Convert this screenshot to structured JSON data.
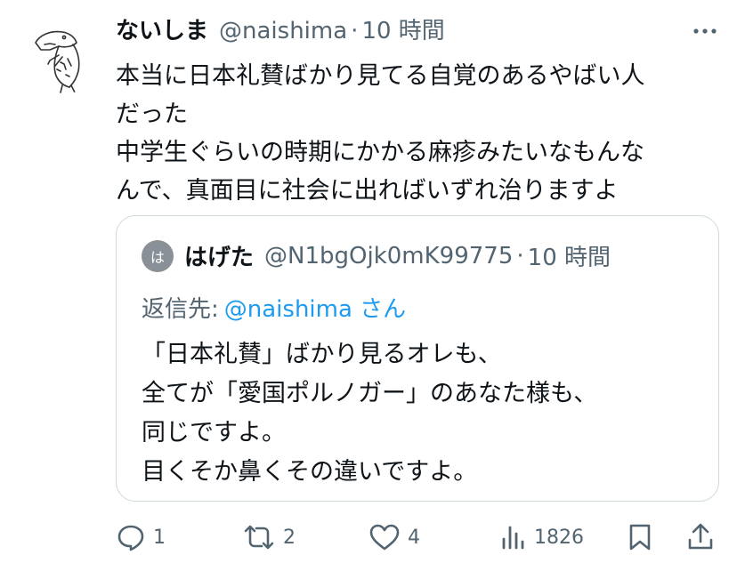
{
  "tweet": {
    "display_name": "ないしま",
    "handle": "@naishima",
    "separator": "·",
    "time": "10 時間",
    "lines": [
      "本当に日本礼賛ばかり見てる自覚のあるやばい人",
      "だった",
      "中学生ぐらいの時期にかかる麻疹みたいなもんな",
      "んで、真面目に社会に出ればいずれ治りますよ"
    ]
  },
  "quote": {
    "avatar_text": "は",
    "display_name": "はげた",
    "handle": "@N1bgOjk0mK99775",
    "separator": "·",
    "time": "10 時間",
    "reply_prefix": "返信先:",
    "reply_mention": "@naishima さん",
    "lines": [
      "「日本礼賛」ばかり見るオレも、",
      "全てが「愛国ポルノガー」のあなた様も、",
      "同じですよ。",
      "目くそか鼻くその違いですよ。"
    ]
  },
  "actions": {
    "reply_count": "1",
    "retweet_count": "2",
    "like_count": "4",
    "views_count": "1826"
  },
  "icons": {
    "more": "more-horizontal-icon",
    "reply": "reply-bubble-icon",
    "retweet": "retweet-arrows-icon",
    "like": "heart-icon",
    "views": "bar-chart-icon",
    "bookmark": "bookmark-icon",
    "share": "share-upload-icon"
  },
  "colors": {
    "text": "#0f1419",
    "secondary": "#536471",
    "link": "#1d9bf0",
    "border": "#cfd9de"
  }
}
